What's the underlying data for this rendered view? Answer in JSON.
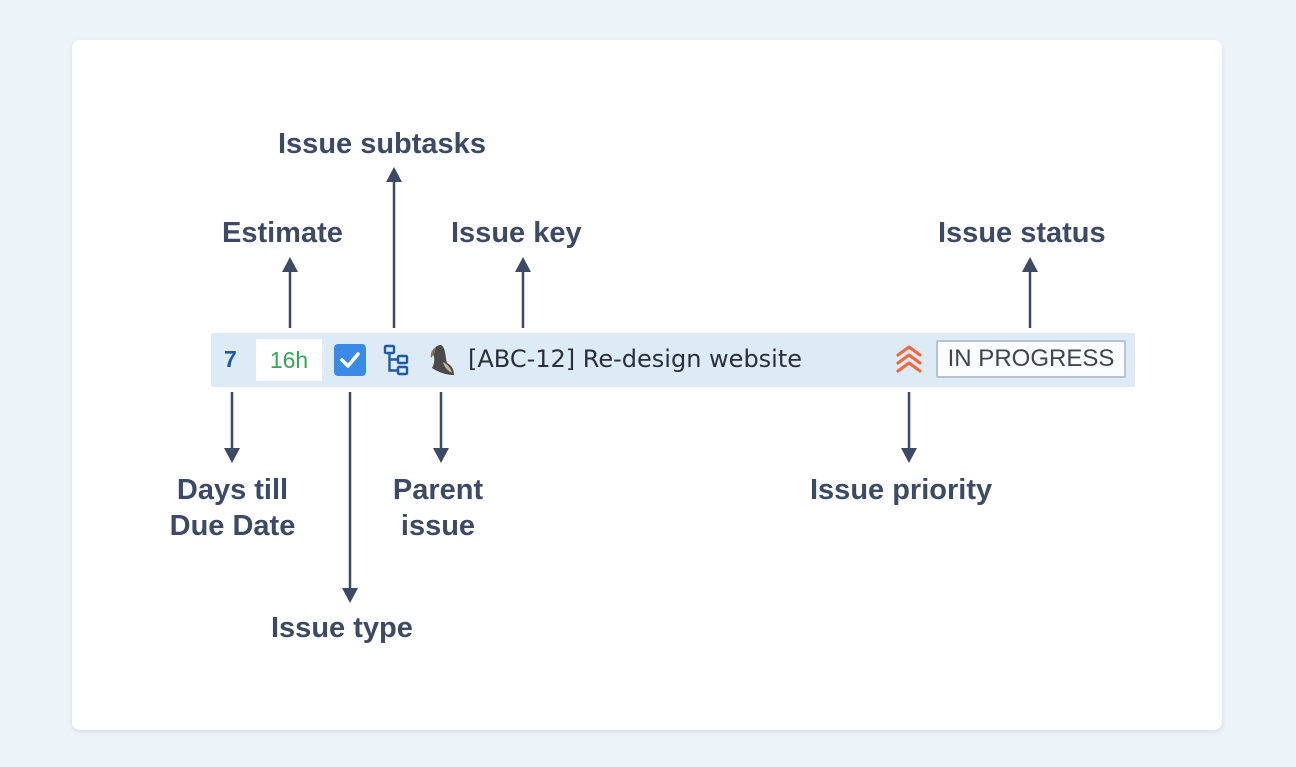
{
  "labels": {
    "issue_subtasks": "Issue subtasks",
    "estimate": "Estimate",
    "issue_key": "Issue key",
    "issue_status": "Issue status",
    "days_till_due_date_line1": "Days till",
    "days_till_due_date_line2": "Due Date",
    "parent_issue_line1": "Parent",
    "parent_issue_line2": "issue",
    "issue_priority": "Issue priority",
    "issue_type": "Issue type"
  },
  "issue_row": {
    "days": "7",
    "estimate": "16h",
    "title": "[ABC-12] Re-design website",
    "status": "IN PROGRESS",
    "issue_type_icon": "checkbox-icon",
    "subtasks_icon": "subtasks-icon",
    "parent_icon": "parent-issue-icon",
    "priority_icon": "highest-priority-icon"
  },
  "colors": {
    "label_text": "#3d4a63",
    "row_background": "#dcebf5",
    "days": "#1e5aa8",
    "estimate": "#34a853",
    "issue_type": "#3a8be6",
    "subtasks": "#1e5aa8",
    "priority": "#f2693d",
    "arrow": "#3d4a63"
  }
}
